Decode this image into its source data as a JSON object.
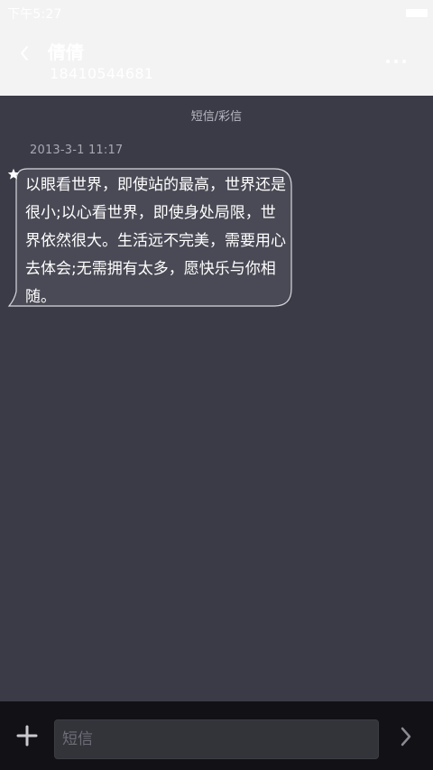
{
  "status_bar": {
    "time": "下午5:27",
    "battery_icon": "battery-icon"
  },
  "header": {
    "back_icon": "chevron-left-icon",
    "contact_name": "倩倩",
    "contact_number": "18410544681",
    "more_icon": "more-dots-icon"
  },
  "conversation": {
    "type_label": "短信/彩信",
    "messages": [
      {
        "timestamp": "2013-3-1 11:17",
        "text": "以眼看世界，即使站的最高，世界还是很小;以心看世界，即使身处局限，世界依然很大。生活远不完美，需要用心去体会;无需拥有太多，愿快乐与你相随。",
        "starred": true,
        "star_icon": "star-icon"
      }
    ]
  },
  "composer": {
    "add_icon": "plus-icon",
    "input_placeholder": "短信",
    "send_icon": "chevron-right-icon"
  },
  "colors": {
    "background": "#3b3b47",
    "header_background": "#f3f3f3",
    "bottom_bar": "#121216",
    "bubble_fill": "#4a4a56",
    "bubble_border": "#d8d8de"
  }
}
